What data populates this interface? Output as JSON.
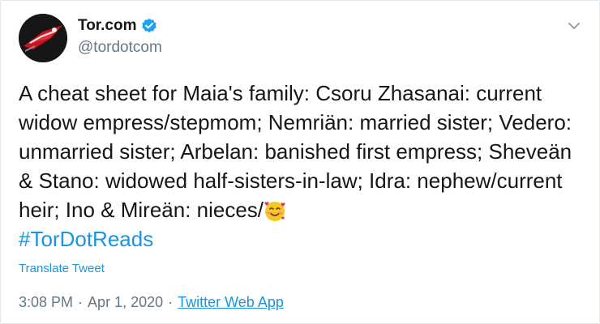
{
  "author": {
    "name": "Tor.com",
    "handle": "@tordotcom",
    "verified": true,
    "avatar_icon": "tor-rocket-logo"
  },
  "tweet": {
    "text": "A cheat sheet for Maia's family: Csoru Zhasanai: current widow empress/stepmom; Nemriän: married sister; Vedero: unmarried sister; Arbelan: banished first empress; Sheveän & Stano: widowed half-sisters-in-law; Idra: nephew/current heir; Ino & Mireän: nieces/",
    "emoji": "smiling-face-with-hearts",
    "hashtag": "#TorDotReads"
  },
  "translate_label": "Translate Tweet",
  "meta": {
    "time": "3:08 PM",
    "date": "Apr 1, 2020",
    "separator": "·",
    "source": "Twitter Web App"
  },
  "colors": {
    "link": "#1b95e0",
    "text": "#14171a",
    "muted": "#657786",
    "verified": "#1da1f2"
  }
}
